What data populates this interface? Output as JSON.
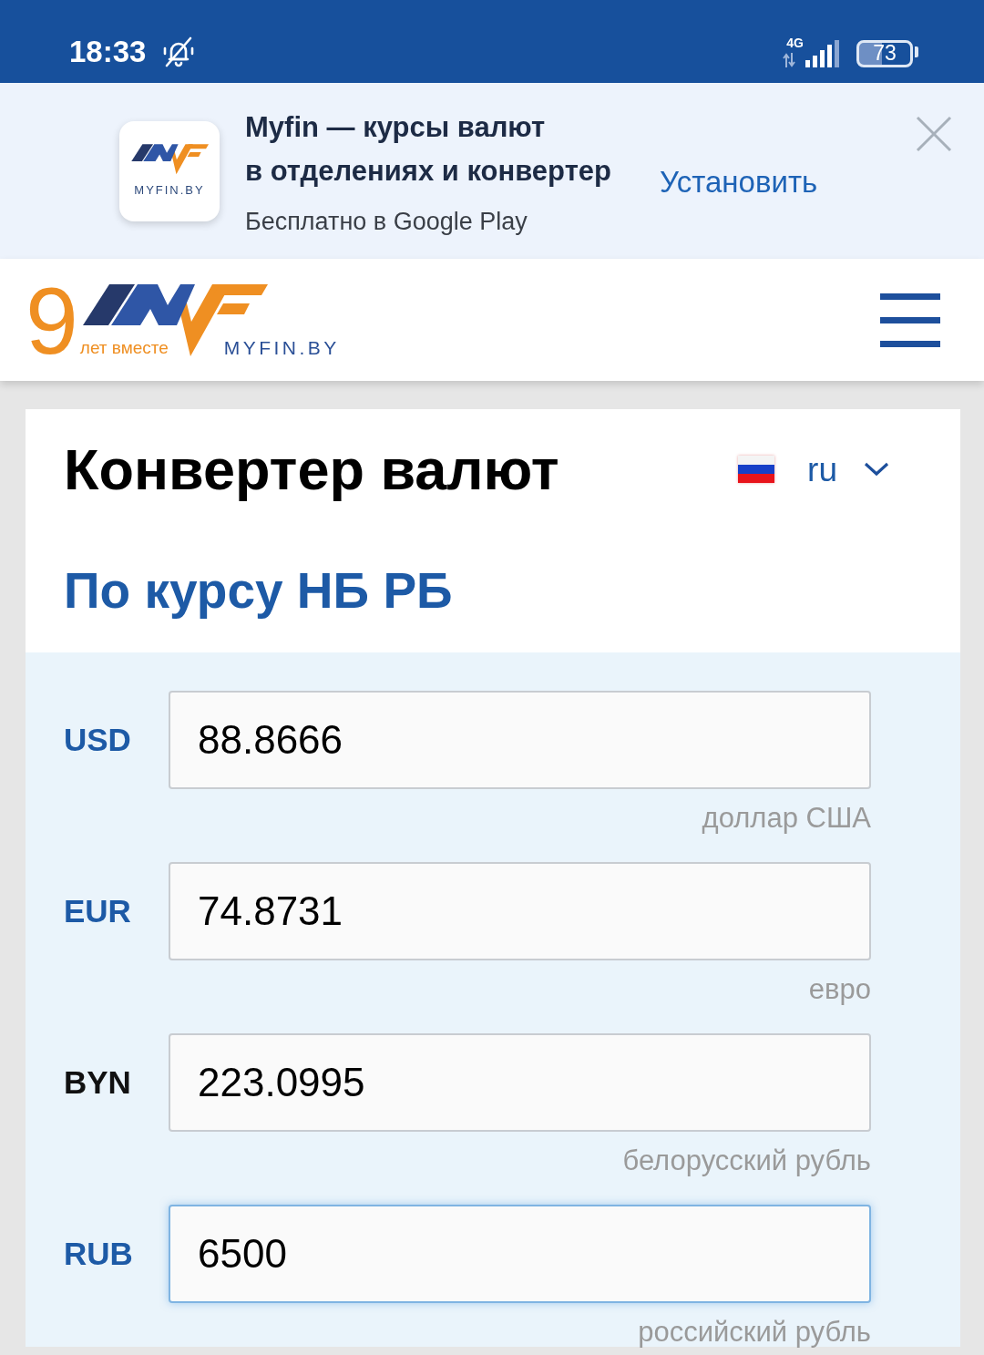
{
  "status_bar": {
    "time": "18:33",
    "network_type": "4G",
    "battery": "73"
  },
  "app_banner": {
    "icon_label": "MYFIN.BY",
    "title": "Myfin — курсы валют\nв отделениях и конвертер",
    "subtitle": "Бесплатно в Google Play",
    "install_button": "Установить"
  },
  "header": {
    "logo": {
      "number": "9",
      "tagline": "лет вместе",
      "wordmark": "MYFIN.BY"
    }
  },
  "converter": {
    "title": "Конвертер валют",
    "language": "ru",
    "subtitle": "По курсу НБ РБ",
    "currencies": [
      {
        "code": "USD",
        "value": "88.8666",
        "name": "доллар США",
        "base": false,
        "focused": false
      },
      {
        "code": "EUR",
        "value": "74.8731",
        "name": "евро",
        "base": false,
        "focused": false
      },
      {
        "code": "BYN",
        "value": "223.0995",
        "name": "белорусский рубль",
        "base": true,
        "focused": false
      },
      {
        "code": "RUB",
        "value": "6500",
        "name": "российский рубль",
        "base": false,
        "focused": true
      }
    ]
  }
}
